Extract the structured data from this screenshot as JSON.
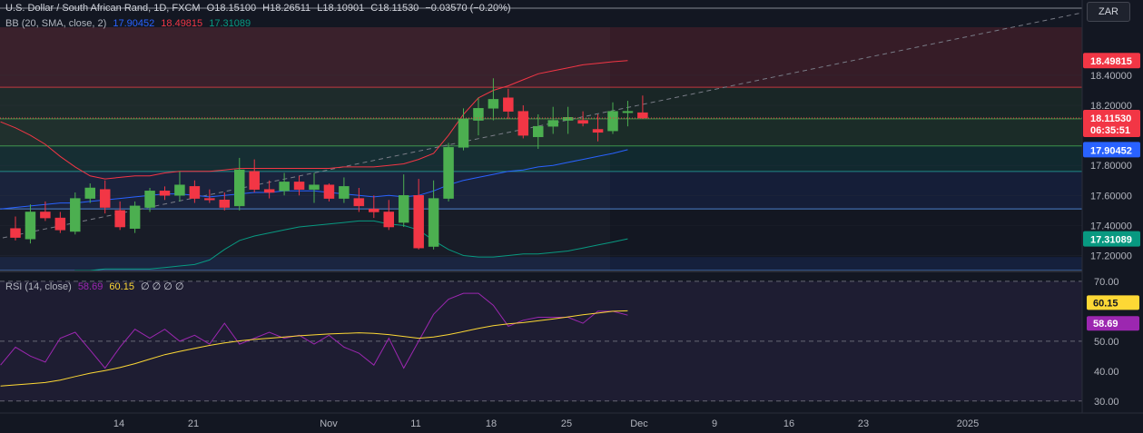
{
  "header": {
    "symbol_title": "U.S. Dollar / South African Rand, 1D, FXCM",
    "open": "O18.15100",
    "high": "H18.26511",
    "low": "L18.10901",
    "close": "C18.11530",
    "change": "−0.03570 (−0.20%)",
    "currency_button": "ZAR"
  },
  "bb_legend": {
    "label": "BB (20, SMA, close, 2)",
    "basis": "17.90452",
    "upper": "18.49815",
    "lower": "17.31089"
  },
  "rsi_legend": {
    "label": "RSI (14, close)",
    "rsi": "58.69",
    "ma": "60.15",
    "extras": "∅ ∅ ∅ ∅"
  },
  "price_tags": {
    "upper": "18.49815",
    "last": "18.11530",
    "countdown": "06:35:51",
    "basis": "17.90452",
    "lower": "17.31089"
  },
  "rsi_tags": {
    "ma": "60.15",
    "rsi": "58.69"
  },
  "colors": {
    "up": "#4caf50",
    "down": "#f23645",
    "bb_basis": "#2962ff",
    "bb_upper": "#f23645",
    "bb_lower": "#089981",
    "rsi_line": "#9c27b0",
    "rsi_ma": "#fdd835"
  },
  "chart_data": [
    {
      "type": "candlestick",
      "title": "U.S. Dollar / South African Rand, 1D, FXCM",
      "y_axis_ticks": [
        "18.40000",
        "18.20000",
        "17.80000",
        "17.60000",
        "17.40000",
        "17.20000"
      ],
      "y_range": [
        17.1,
        18.72
      ],
      "x_axis_ticks": [
        "14",
        "21",
        "Nov",
        "11",
        "18",
        "25",
        "Dec",
        "9",
        "16",
        "23",
        "2025"
      ],
      "candles": [
        {
          "o": 17.38,
          "h": 17.46,
          "l": 17.3,
          "c": 17.32
        },
        {
          "o": 17.31,
          "h": 17.54,
          "l": 17.28,
          "c": 17.49
        },
        {
          "o": 17.49,
          "h": 17.56,
          "l": 17.43,
          "c": 17.45
        },
        {
          "o": 17.45,
          "h": 17.49,
          "l": 17.35,
          "c": 17.37
        },
        {
          "o": 17.36,
          "h": 17.62,
          "l": 17.34,
          "c": 17.58
        },
        {
          "o": 17.58,
          "h": 17.68,
          "l": 17.55,
          "c": 17.65
        },
        {
          "o": 17.64,
          "h": 17.7,
          "l": 17.48,
          "c": 17.52
        },
        {
          "o": 17.5,
          "h": 17.56,
          "l": 17.37,
          "c": 17.39
        },
        {
          "o": 17.38,
          "h": 17.56,
          "l": 17.35,
          "c": 17.53
        },
        {
          "o": 17.52,
          "h": 17.65,
          "l": 17.49,
          "c": 17.63
        },
        {
          "o": 17.63,
          "h": 17.66,
          "l": 17.57,
          "c": 17.6
        },
        {
          "o": 17.6,
          "h": 17.76,
          "l": 17.56,
          "c": 17.67
        },
        {
          "o": 17.66,
          "h": 17.7,
          "l": 17.55,
          "c": 17.58
        },
        {
          "o": 17.58,
          "h": 17.64,
          "l": 17.55,
          "c": 17.57
        },
        {
          "o": 17.57,
          "h": 17.62,
          "l": 17.5,
          "c": 17.52
        },
        {
          "o": 17.53,
          "h": 17.85,
          "l": 17.5,
          "c": 17.77
        },
        {
          "o": 17.76,
          "h": 17.84,
          "l": 17.62,
          "c": 17.64
        },
        {
          "o": 17.64,
          "h": 17.7,
          "l": 17.58,
          "c": 17.62
        },
        {
          "o": 17.63,
          "h": 17.75,
          "l": 17.6,
          "c": 17.69
        },
        {
          "o": 17.69,
          "h": 17.73,
          "l": 17.6,
          "c": 17.64
        },
        {
          "o": 17.64,
          "h": 17.75,
          "l": 17.55,
          "c": 17.67
        },
        {
          "o": 17.67,
          "h": 17.68,
          "l": 17.56,
          "c": 17.58
        },
        {
          "o": 17.58,
          "h": 17.72,
          "l": 17.55,
          "c": 17.66
        },
        {
          "o": 17.58,
          "h": 17.65,
          "l": 17.49,
          "c": 17.53
        },
        {
          "o": 17.51,
          "h": 17.6,
          "l": 17.45,
          "c": 17.49
        },
        {
          "o": 17.49,
          "h": 17.57,
          "l": 17.37,
          "c": 17.39
        },
        {
          "o": 17.42,
          "h": 17.74,
          "l": 17.39,
          "c": 17.6
        },
        {
          "o": 17.6,
          "h": 17.71,
          "l": 17.24,
          "c": 17.25
        },
        {
          "o": 17.26,
          "h": 17.7,
          "l": 17.24,
          "c": 17.58
        },
        {
          "o": 17.58,
          "h": 17.95,
          "l": 17.56,
          "c": 17.92
        },
        {
          "o": 17.92,
          "h": 18.18,
          "l": 17.9,
          "c": 18.11
        },
        {
          "o": 18.1,
          "h": 18.25,
          "l": 18.0,
          "c": 18.18
        },
        {
          "o": 18.18,
          "h": 18.38,
          "l": 18.1,
          "c": 18.24
        },
        {
          "o": 18.25,
          "h": 18.31,
          "l": 18.11,
          "c": 18.16
        },
        {
          "o": 18.16,
          "h": 18.2,
          "l": 17.98,
          "c": 18.0
        },
        {
          "o": 17.99,
          "h": 18.14,
          "l": 17.91,
          "c": 18.06
        },
        {
          "o": 18.06,
          "h": 18.19,
          "l": 18.01,
          "c": 18.1
        },
        {
          "o": 18.1,
          "h": 18.19,
          "l": 18.01,
          "c": 18.12
        },
        {
          "o": 18.1,
          "h": 18.16,
          "l": 18.06,
          "c": 18.08
        },
        {
          "o": 18.04,
          "h": 18.14,
          "l": 17.96,
          "c": 18.02
        },
        {
          "o": 18.03,
          "h": 18.22,
          "l": 18.01,
          "c": 18.16
        },
        {
          "o": 18.16,
          "h": 18.23,
          "l": 18.06,
          "c": 18.16
        },
        {
          "o": 18.151,
          "h": 18.26511,
          "l": 18.10901,
          "c": 18.1153
        }
      ],
      "bollinger": {
        "basis": [
          17.51,
          17.52,
          17.53,
          17.54,
          17.55,
          17.55,
          17.56,
          17.57,
          17.58,
          17.59,
          17.6,
          17.61,
          17.61,
          17.6,
          17.59,
          17.6,
          17.61,
          17.62,
          17.62,
          17.63,
          17.63,
          17.63,
          17.62,
          17.61,
          17.6,
          17.59,
          17.6,
          17.59,
          17.6,
          17.63,
          17.67,
          17.7,
          17.72,
          17.74,
          17.76,
          17.77,
          17.79,
          17.8,
          17.82,
          17.84,
          17.86,
          17.88,
          17.90452
        ],
        "upper": [
          18.09,
          18.05,
          18.0,
          17.94,
          17.86,
          17.79,
          17.73,
          17.71,
          17.72,
          17.73,
          17.73,
          17.75,
          17.76,
          17.76,
          17.76,
          17.77,
          17.78,
          17.78,
          17.78,
          17.78,
          17.78,
          17.78,
          17.78,
          17.79,
          17.79,
          17.79,
          17.8,
          17.81,
          17.84,
          17.88,
          18.0,
          18.14,
          18.25,
          18.3,
          18.33,
          18.37,
          18.41,
          18.43,
          18.45,
          18.47,
          18.48,
          18.49,
          18.49815
        ],
        "lower": [
          16.9,
          16.92,
          16.95,
          16.98,
          17.04,
          17.1,
          17.1,
          17.11,
          17.11,
          17.11,
          17.11,
          17.12,
          17.13,
          17.14,
          17.17,
          17.24,
          17.3,
          17.33,
          17.35,
          17.37,
          17.39,
          17.4,
          17.41,
          17.42,
          17.43,
          17.43,
          17.41,
          17.4,
          17.37,
          17.3,
          17.24,
          17.2,
          17.19,
          17.19,
          17.2,
          17.21,
          17.21,
          17.22,
          17.23,
          17.25,
          17.27,
          17.29,
          17.31089
        ]
      }
    },
    {
      "type": "line",
      "title": "RSI (14, close)",
      "y_axis_ticks": [
        "70.00",
        "50.00",
        "40.00",
        "30.00"
      ],
      "y_range": [
        26,
        73
      ],
      "band": [
        30,
        70
      ],
      "middle": 50,
      "series": [
        {
          "name": "RSI",
          "values": [
            42,
            48,
            45,
            43,
            51,
            53,
            47,
            41,
            48,
            54,
            51,
            54,
            50,
            52,
            49,
            56,
            49,
            51,
            53,
            51,
            52,
            49,
            52,
            48,
            46,
            42,
            51,
            41,
            50,
            59,
            64,
            66,
            66,
            62,
            55,
            57,
            58,
            58,
            58,
            56,
            60,
            60,
            58.69
          ]
        },
        {
          "name": "RSI MA",
          "values": [
            35,
            35.4,
            35.8,
            36.2,
            37,
            38.2,
            39.3,
            40.2,
            41.2,
            42.5,
            44,
            45.5,
            46.6,
            47.6,
            48.6,
            49.4,
            50.1,
            50.6,
            51,
            51.4,
            51.8,
            52.1,
            52.4,
            52.6,
            52.8,
            52.6,
            52.2,
            51.6,
            51,
            51.4,
            52.2,
            53.2,
            54.3,
            55.2,
            55.8,
            56.2,
            56.8,
            57.4,
            58.1,
            58.8,
            59.4,
            60,
            60.15
          ]
        }
      ]
    }
  ]
}
